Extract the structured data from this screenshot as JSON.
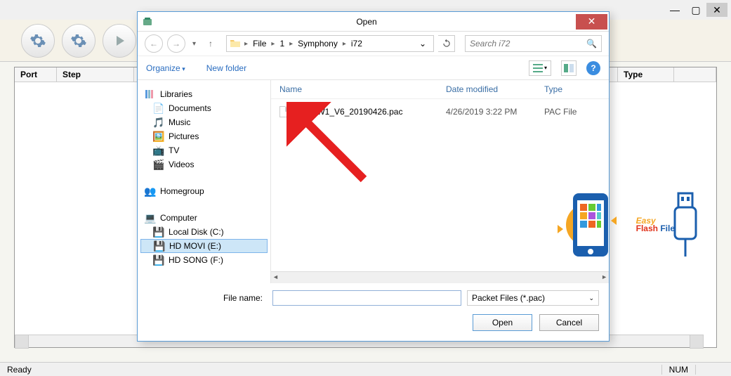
{
  "main_window": {
    "table_columns": {
      "port": "Port",
      "step": "Step",
      "type": "Type"
    },
    "status": {
      "ready": "Ready",
      "num": "NUM"
    }
  },
  "dialog": {
    "title": "Open",
    "nav": {
      "breadcrumb": [
        "File",
        "1",
        "Symphony",
        "i72"
      ],
      "search_placeholder": "Search i72"
    },
    "toolbar": {
      "organize": "Organize",
      "new_folder": "New folder"
    },
    "tree": {
      "libraries": {
        "label": "Libraries",
        "children": [
          "Documents",
          "Music",
          "Pictures",
          "TV",
          "Videos"
        ]
      },
      "homegroup": {
        "label": "Homegroup"
      },
      "computer": {
        "label": "Computer",
        "children": [
          "Local Disk (C:)",
          "HD MOVI (E:)",
          "HD SONG (F:)"
        ]
      }
    },
    "file_headers": {
      "name": "Name",
      "date": "Date modified",
      "type": "Type"
    },
    "files": [
      {
        "name": "i72_HW1_V6_20190426.pac",
        "date": "4/26/2019 3:22 PM",
        "type": "PAC File"
      }
    ],
    "footer": {
      "filename_label": "File name:",
      "filename_value": "",
      "filetype": "Packet Files (*.pac)",
      "open": "Open",
      "cancel": "Cancel"
    }
  },
  "watermark": {
    "line1": "Easy",
    "line2a": "Flash",
    "line2b": " File"
  }
}
